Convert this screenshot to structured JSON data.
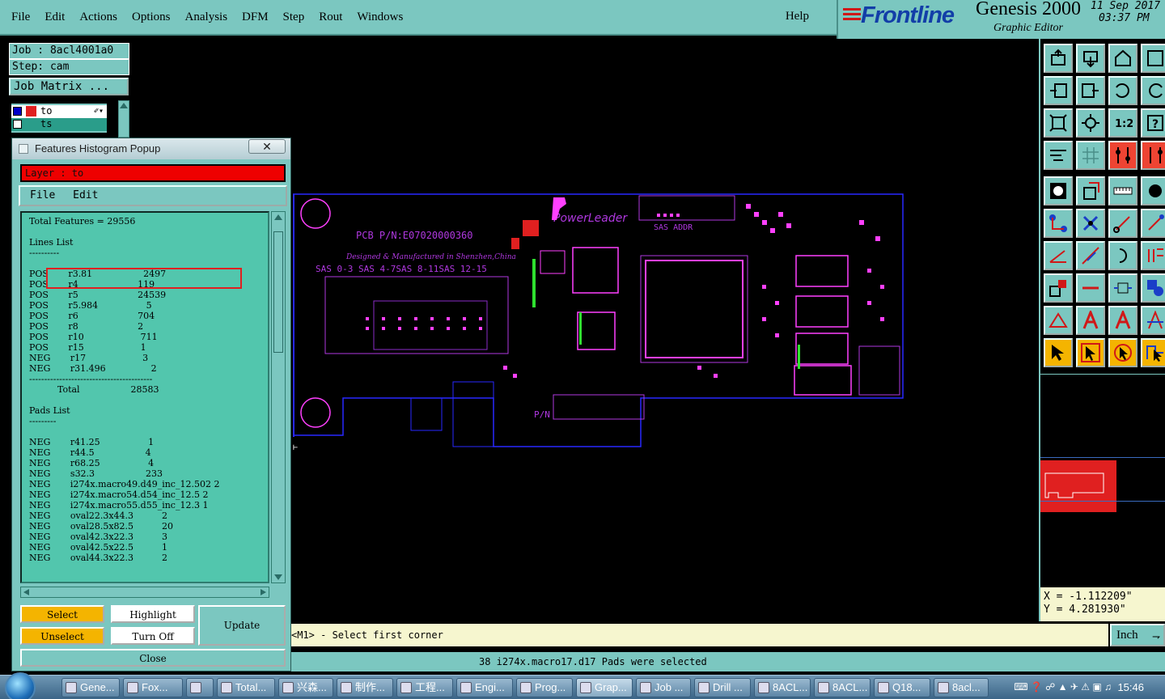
{
  "menu": {
    "items": [
      "File",
      "Edit",
      "Actions",
      "Options",
      "Analysis",
      "DFM",
      "Step",
      "Rout",
      "Windows"
    ],
    "help": "Help"
  },
  "brand": {
    "name": "Frontline",
    "product": "Genesis 2000",
    "subtitle": "Graphic Editor",
    "date": "11 Sep 2017",
    "time": "03:37 PM",
    "colors": {
      "brand_blue": "#123ea8",
      "brand_red": "#d01818"
    }
  },
  "job": {
    "job_label": "Job : 8acl4001a0",
    "step_label": "Step: cam",
    "matrix_button": "Job Matrix ...",
    "layers": [
      {
        "name": "to",
        "active": true
      },
      {
        "name": "ts",
        "active": false
      }
    ]
  },
  "popup": {
    "title": "Features Histogram Popup",
    "close_glyph": "✕",
    "layer_label": "Layer :  to",
    "menu": [
      "File",
      "Edit"
    ],
    "lines": [
      "Total Features = 29556",
      "",
      "Lines List",
      "----------",
      "",
      "POS       r3.81                  2497",
      "POS       r4                     119",
      "POS       r5                     24539",
      "POS       r5.984                 5",
      "POS       r6                     704",
      "POS       r8                     2",
      "POS       r10                    711",
      "POS       r15                    1",
      "NEG       r17                    3",
      "NEG       r31.496                2",
      "-----------------------------------------",
      "          Total                  28583",
      "",
      "Pads List",
      "---------",
      "",
      "NEG       r41.25                 1",
      "NEG       r44.5                  4",
      "NEG       r68.25                 4",
      "NEG       s32.3                  233",
      "NEG       i274x.macro49.d49_inc_12.502 2",
      "NEG       i274x.macro54.d54_inc_12.5 2",
      "NEG       i274x.macro55.d55_inc_12.3 1",
      "NEG       oval22.3x44.3          2",
      "NEG       oval28.5x82.5          20",
      "NEG       oval42.3x22.3          3",
      "NEG       oval42.5x22.5          1",
      "NEG       oval44.3x22.3          2"
    ],
    "buttons": {
      "select": "Select",
      "highlight": "Highlight",
      "update": "Update",
      "unselect": "Unselect",
      "turn_off": "Turn Off",
      "close": "Close"
    },
    "colors": {
      "list_bg": "#52c6ad",
      "button_yellow": "#f4b400",
      "layer_red": "#e00000"
    }
  },
  "board": {
    "part_number": "PCB P/N:E07020000360",
    "company": "PowerLeader",
    "made_in": "Designed & Manufactured in Shenzhen,China",
    "sas_ports": "SAS 0-3 SAS 4-7SAS 8-11SAS 12-15",
    "sas_addr": "SAS ADDR",
    "pn_label": "P/N",
    "colors": {
      "outline": "#2828ff",
      "silk": "#b038e0",
      "pad": "#ff40ff",
      "green": "#2fe22f",
      "red": "#e02020"
    }
  },
  "coords": {
    "x": "X =  -1.112209\"",
    "y": "Y =  4.281930\""
  },
  "status": {
    "prompt": "<M1> - Select first corner",
    "units": "Inch",
    "message": "38 i274x.macro17.d17 Pads were selected"
  },
  "taskbar": {
    "items": [
      "Gene...",
      "Fox...",
      "",
      "Total...",
      "兴森...",
      "制作...",
      "工程...",
      "Engi...",
      "Prog...",
      "Grap...",
      "Job ...",
      "Drill ...",
      "8ACL...",
      "8ACL...",
      "Q18...",
      "8acl..."
    ],
    "clock": "15:46"
  }
}
